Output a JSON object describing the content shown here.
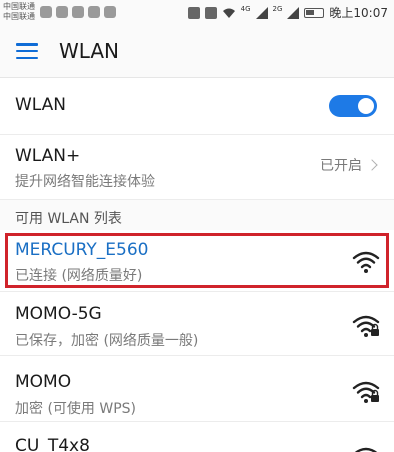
{
  "status_bar": {
    "carrier_1": "中国联通",
    "carrier_2": "中国联通",
    "signal_1": "4G",
    "signal_2": "2G",
    "time": "晚上10:07"
  },
  "appbar": {
    "title": "WLAN"
  },
  "wlan_toggle": {
    "label": "WLAN",
    "state": "on"
  },
  "wlan_plus": {
    "label": "WLAN+",
    "subtitle": "提升网络智能连接体验",
    "status": "已开启"
  },
  "section": {
    "title": "可用 WLAN 列表"
  },
  "networks": [
    {
      "ssid": "MERCURY_E560",
      "status": "已连接 (网络质量好)",
      "connected": true,
      "secured": false,
      "icon": "wifi-full-icon"
    },
    {
      "ssid": "MOMO-5G",
      "status": "已保存，加密 (网络质量一般)",
      "connected": false,
      "secured": true,
      "icon": "wifi-lock-icon"
    },
    {
      "ssid": "MOMO",
      "status": "加密 (可使用 WPS)",
      "connected": false,
      "secured": true,
      "icon": "wifi-lock-icon"
    },
    {
      "ssid": "CU_T4x8",
      "status": "",
      "connected": false,
      "secured": false,
      "icon": "wifi-icon"
    }
  ],
  "colors": {
    "accent": "#1e7ae6",
    "connected_text": "#1a6fc4",
    "highlight": "#d0232b"
  }
}
